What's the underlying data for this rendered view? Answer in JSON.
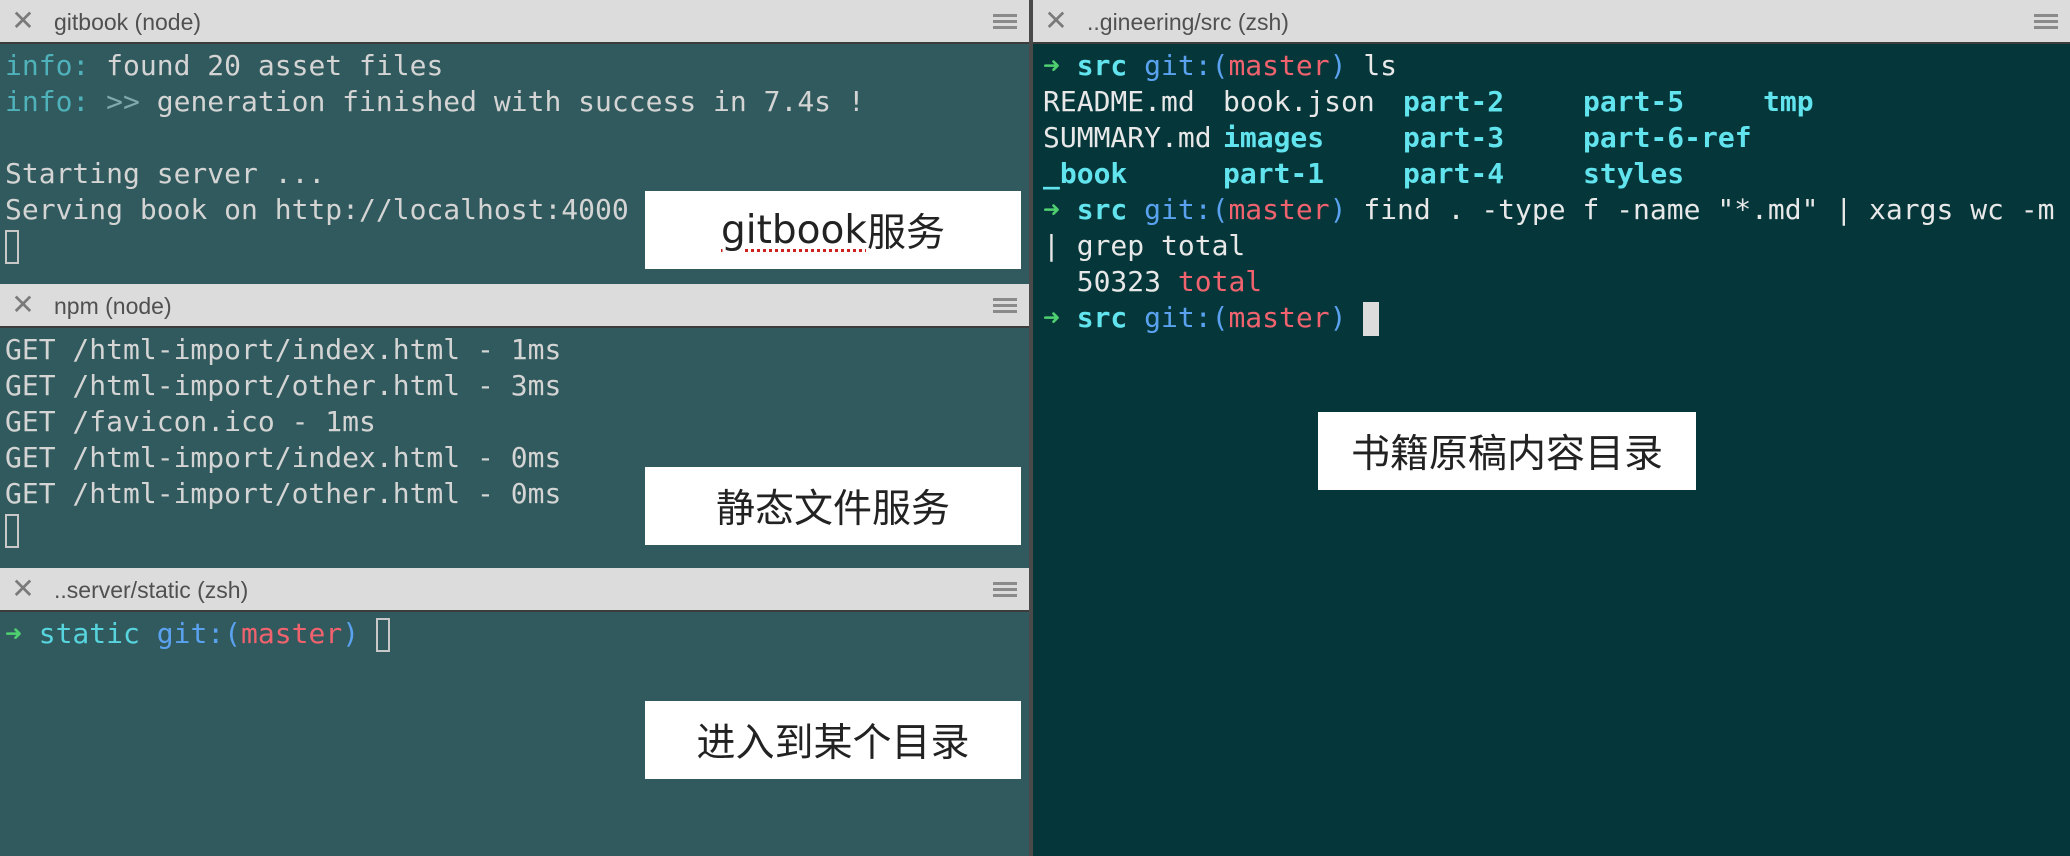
{
  "panes": {
    "gitbook": {
      "title": "gitbook (node)",
      "info_prefix": "info:",
      "line1": " found 20 asset files",
      "line2_arrow": " >>",
      "line2": " generation finished with success in 7.4s !",
      "line3": "Starting server ...",
      "line4": "Serving book on http://localhost:4000",
      "label_word": "gitbook",
      "label_rest": " 服务"
    },
    "npm": {
      "title": "npm (node)",
      "lines": [
        "GET /html-import/index.html - 1ms",
        "GET /html-import/other.html - 3ms",
        "GET /favicon.ico - 1ms",
        "GET /html-import/index.html - 0ms",
        "GET /html-import/other.html - 0ms"
      ],
      "label": "静态文件服务"
    },
    "static": {
      "title": "..server/static (zsh)",
      "prompt_arrow": "➜",
      "dir": "static",
      "git": "git:(",
      "branch": "master",
      "git_close": ")",
      "label": "进入到某个目录"
    },
    "src": {
      "title": "..gineering/src (zsh)",
      "prompt_arrow": "➜",
      "dir": "src",
      "git": "git:(",
      "branch": "master",
      "git_close": ")",
      "cmd1": " ls",
      "ls_rows": [
        [
          "README.md",
          "book.json",
          "part-2",
          "part-5",
          "tmp"
        ],
        [
          "SUMMARY.md",
          "images",
          "part-3",
          "part-6-ref",
          ""
        ],
        [
          "_book",
          "part-1",
          "part-4",
          "styles",
          ""
        ]
      ],
      "cmd2": " find . -type f -name \"*.md\" | xargs wc -m",
      "cmd2_cont": "| grep total",
      "count": "  50323",
      "count_word": "total",
      "label": "书籍原稿内容目录"
    }
  },
  "colors": {
    "pane_bg": "#305a5d",
    "pane_bg_dark": "#04363a",
    "prompt_arrow": "#4fd070",
    "directory": "#62e4ee",
    "git": "#5aa2ef",
    "branch": "#f0636e"
  },
  "icons": {
    "close": "close-icon",
    "menu": "hamburger-menu-icon"
  }
}
